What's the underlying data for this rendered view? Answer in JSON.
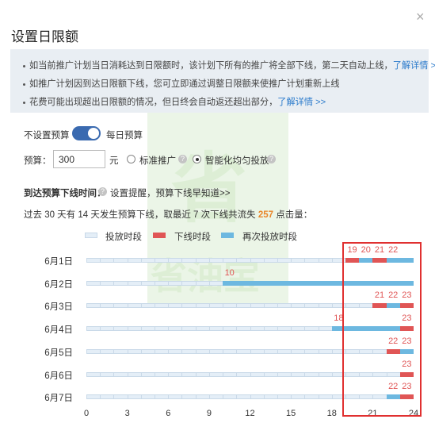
{
  "dialog": {
    "title": "设置日限额",
    "close_glyph": "×"
  },
  "notice": {
    "items": [
      {
        "text": "如当前推广计划当日消耗达到日限额时，该计划下所有的推广将全部下线，第二天自动上线，",
        "link": "了解详情 >>"
      },
      {
        "text": "如推广计划因到达日限额下线，您可立即通过调整日限额来使推广计划重新上线",
        "link": ""
      },
      {
        "text": "花费可能出现超出日限额的情况，但日终会自动返还超出部分，",
        "link": "了解详情 >>"
      }
    ]
  },
  "budget_mode": {
    "left_label": "不设置预算",
    "right_label": "每日预算",
    "enabled": true
  },
  "budget": {
    "label": "预算：",
    "value": "300",
    "unit": "元",
    "options": [
      {
        "label": "标准推广",
        "selected": false
      },
      {
        "label": "智能化均匀投放",
        "selected": true
      }
    ]
  },
  "offline_time": {
    "label": "到达预算下线时间：",
    "link": "设置提醒，预算下线早知道>>"
  },
  "summary": {
    "prefix": "过去 30 天有 14 天发生预算下线，取最近 7 次下线共流失",
    "highlight": "257",
    "suffix": "点击量："
  },
  "legend": [
    {
      "label": "投放时段",
      "color": "#e4eef7"
    },
    {
      "label": "下线时段",
      "color": "#e05555"
    },
    {
      "label": "再次投放时段",
      "color": "#6db8e0"
    }
  ],
  "watermark": {
    "chars": [
      "省",
      "省油宝"
    ]
  },
  "chart_data": {
    "type": "timeline",
    "x_ticks": [
      "0",
      "3",
      "6",
      "9",
      "12",
      "15",
      "18",
      "21",
      "24"
    ],
    "xlim": [
      0,
      24
    ],
    "days": [
      {
        "label": "6月1日",
        "offline": [
          [
            19,
            20
          ],
          [
            21,
            22
          ]
        ],
        "resume": [
          [
            20,
            21
          ],
          [
            22,
            24
          ]
        ],
        "hour_labels": [
          "19",
          "20",
          "21",
          "22"
        ]
      },
      {
        "label": "6月2日",
        "offline": [],
        "resume": [
          [
            10,
            24
          ]
        ],
        "hour_labels": [
          "10"
        ]
      },
      {
        "label": "6月3日",
        "offline": [
          [
            21,
            22
          ],
          [
            23,
            24
          ]
        ],
        "resume": [
          [
            22,
            23
          ]
        ],
        "hour_labels": [
          "21",
          "22",
          "23"
        ]
      },
      {
        "label": "6月4日",
        "offline": [
          [
            23,
            24
          ]
        ],
        "resume": [
          [
            18,
            23
          ]
        ],
        "hour_labels": [
          "18",
          "23"
        ]
      },
      {
        "label": "6月5日",
        "offline": [
          [
            22,
            23
          ]
        ],
        "resume": [
          [
            23,
            24
          ]
        ],
        "hour_labels": [
          "22",
          "23"
        ]
      },
      {
        "label": "6月6日",
        "offline": [
          [
            23,
            24
          ]
        ],
        "resume": [],
        "hour_labels": [
          "23"
        ]
      },
      {
        "label": "6月7日",
        "offline": [
          [
            23,
            24
          ]
        ],
        "resume": [
          [
            22,
            23
          ]
        ],
        "hour_labels": [
          "22",
          "23"
        ]
      }
    ]
  }
}
